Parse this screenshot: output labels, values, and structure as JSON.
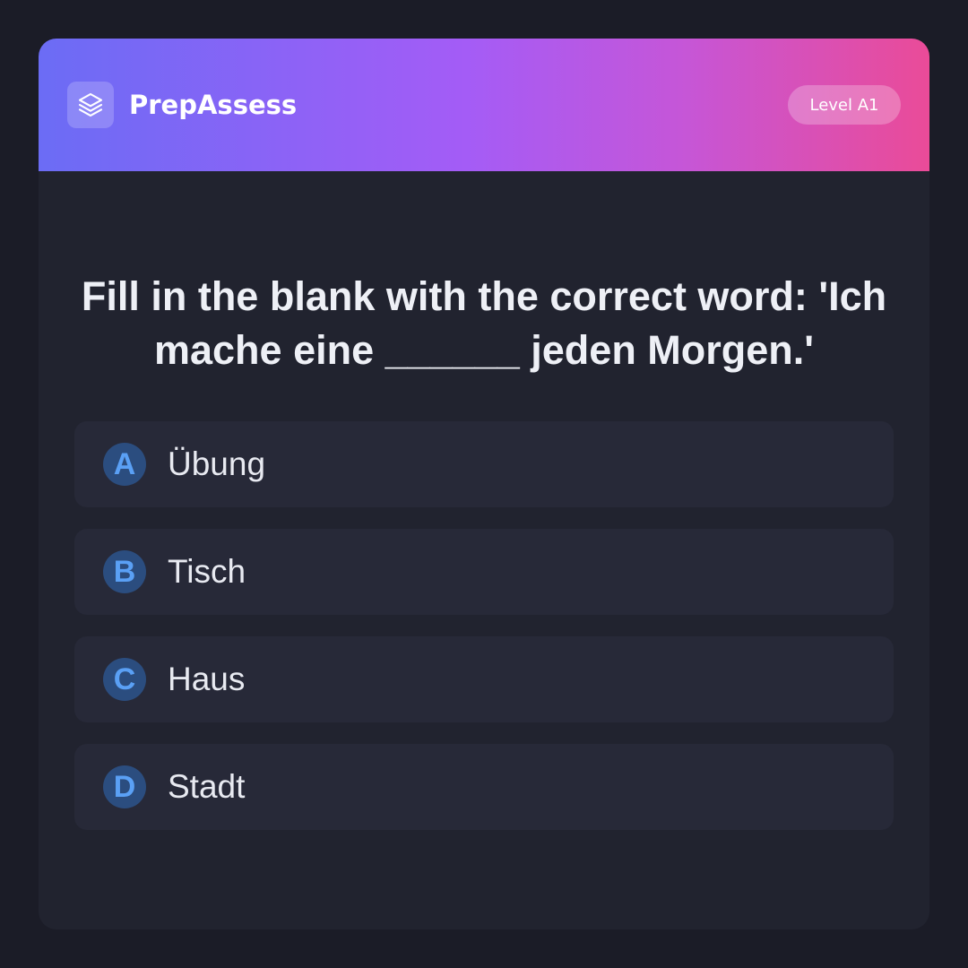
{
  "app": {
    "brand": "PrepAssess",
    "brand_icon": "layers-icon",
    "level_badge": "Level A1"
  },
  "question": {
    "text": "Fill in the blank with the correct word: 'Ich mache eine ______ jeden Morgen.'"
  },
  "options": [
    {
      "letter": "A",
      "text": "Übung"
    },
    {
      "letter": "B",
      "text": "Tisch"
    },
    {
      "letter": "C",
      "text": "Haus"
    },
    {
      "letter": "D",
      "text": "Stadt"
    }
  ],
  "colors": {
    "page_background": "#1b1c27",
    "card_background": "#21232f",
    "header_gradient": [
      "#6b6cf5",
      "#a45cf6",
      "#ea4b98"
    ],
    "option_background": "#272938",
    "letter_circle": "#2b4d7f",
    "letter_text": "#5aa0f5"
  }
}
